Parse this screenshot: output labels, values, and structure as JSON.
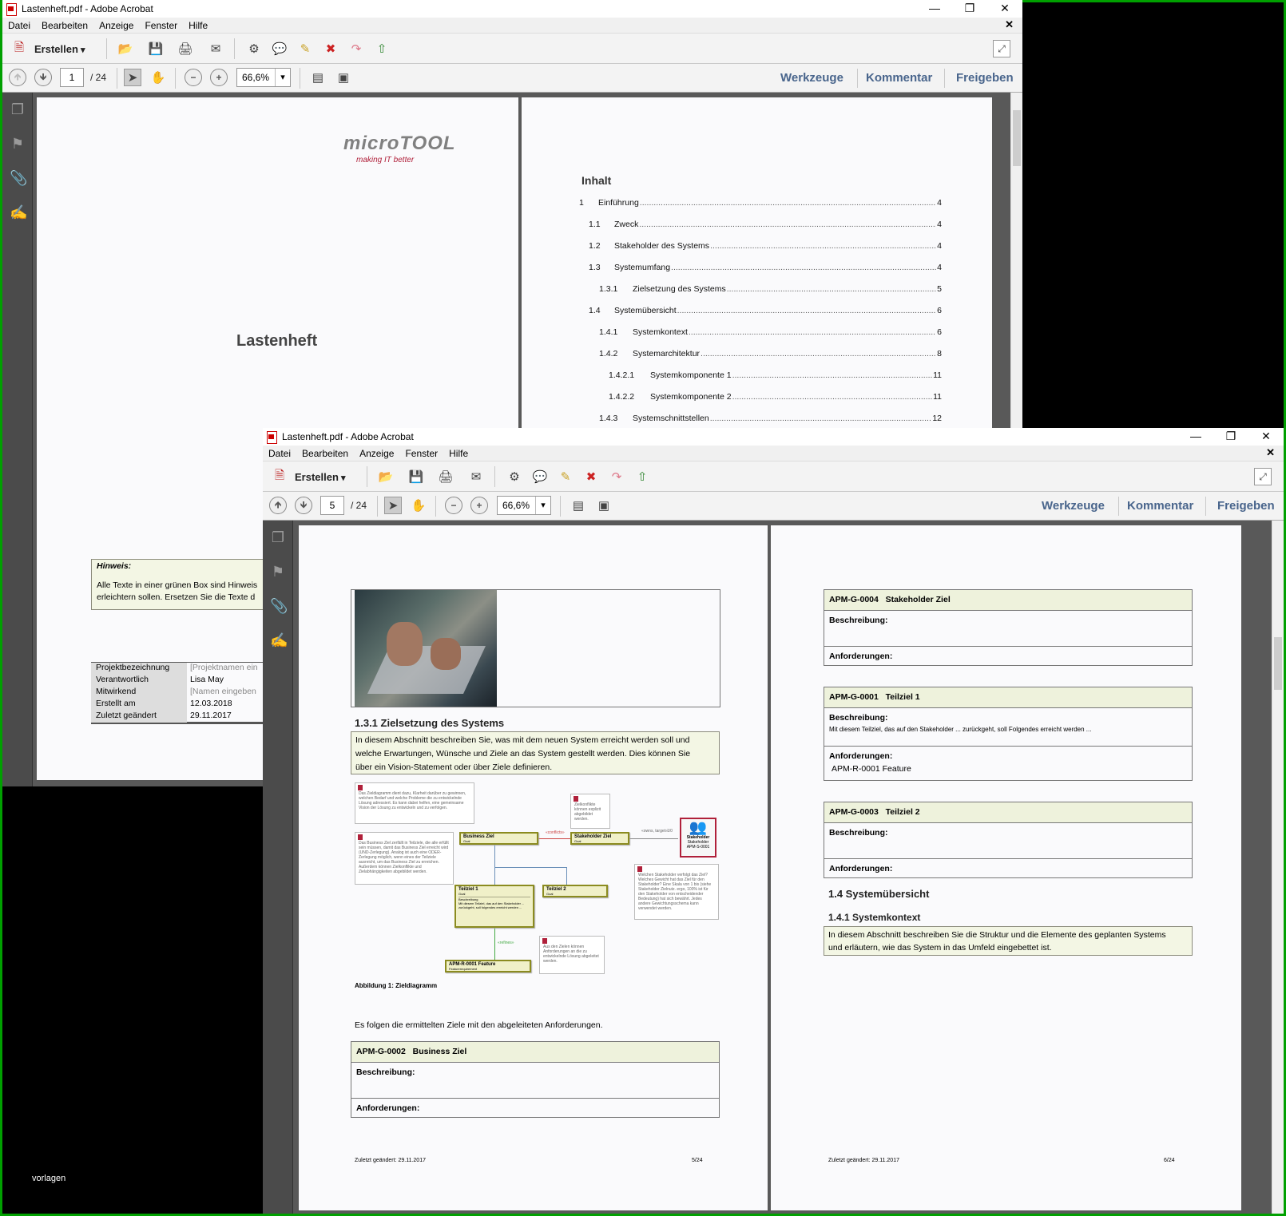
{
  "colors": {
    "frame_border": "#00a000",
    "link_blue": "#49658c",
    "note_green": "#f3f6e4",
    "req_header": "#eef2dc"
  },
  "window1": {
    "title": "Lastenheft.pdf - Adobe Acrobat",
    "menu": [
      "Datei",
      "Bearbeiten",
      "Anzeige",
      "Fenster",
      "Hilfe"
    ],
    "erstellen": "Erstellen",
    "page_current": "1",
    "page_total": "/ 24",
    "zoom": "66,6%",
    "right_links": [
      "Werkzeuge",
      "Kommentar",
      "Freigeben"
    ],
    "cover": {
      "logo": "microTOOL",
      "slogan": "making IT better",
      "title": "Lastenheft",
      "hint_title": "Hinweis:",
      "hint_lines": [
        "Alle Texte in einer grünen Box sind Hinweis",
        "erleichtern sollen. Ersetzen Sie die Texte d"
      ],
      "meta": [
        {
          "k": "Projektbezeichnung",
          "v": "[Projektnamen ein"
        },
        {
          "k": "Verantwortlich",
          "v": "Lisa May"
        },
        {
          "k": "Mitwirkend",
          "v": "[Namen eingeben"
        },
        {
          "k": "Erstellt am",
          "v": "12.03.2018"
        },
        {
          "k": "Zuletzt geändert",
          "v": "29.11.2017"
        }
      ],
      "footer_text": "vorlagen"
    },
    "toc_title": "Inhalt",
    "toc": [
      {
        "num": "1",
        "text": "Einführung",
        "page": "4"
      },
      {
        "num": "1.1",
        "text": "Zweck",
        "page": "4"
      },
      {
        "num": "1.2",
        "text": "Stakeholder des Systems",
        "page": "4"
      },
      {
        "num": "1.3",
        "text": "Systemumfang",
        "page": "4"
      },
      {
        "num": "1.3.1",
        "text": "Zielsetzung des Systems",
        "page": "5"
      },
      {
        "num": "1.4",
        "text": "Systemübersicht",
        "page": "6"
      },
      {
        "num": "1.4.1",
        "text": "Systemkontext",
        "page": "6"
      },
      {
        "num": "1.4.2",
        "text": "Systemarchitektur",
        "page": "8"
      },
      {
        "num": "1.4.2.1",
        "text": "Systemkomponente 1",
        "page": "11"
      },
      {
        "num": "1.4.2.2",
        "text": "Systemkomponente 2",
        "page": "11"
      },
      {
        "num": "1.4.3",
        "text": "Systemschnittstellen",
        "page": "12"
      }
    ]
  },
  "window2": {
    "title": "Lastenheft.pdf - Adobe Acrobat",
    "menu": [
      "Datei",
      "Bearbeiten",
      "Anzeige",
      "Fenster",
      "Hilfe"
    ],
    "erstellen": "Erstellen",
    "page_current": "5",
    "page_total": "/ 24",
    "zoom": "66,6%",
    "right_links": [
      "Werkzeuge",
      "Kommentar",
      "Freigeben"
    ],
    "page5": {
      "section_heading": "1.3.1  Zielsetzung des Systems",
      "intro_lines": [
        "In diesem Abschnitt beschreiben Sie, was mit dem neuen System erreicht werden soll und",
        "welche Erwartungen, Wünsche und Ziele an das System gestellt werden. Dies können Sie",
        "über ein Vision-Statement oder über Ziele definieren."
      ],
      "diagram": {
        "business_goal": "Business Ziel",
        "business_goal_sub": "Goal",
        "stakeholder_goal": "Stakeholder Ziel",
        "stakeholder_goal_sub": "Goal",
        "partial1": "Teilziel 1",
        "partial1_sub": "Goal",
        "partial1_desc": "Beschreibung",
        "partial1_text": "Mit diesem Teilziel, das auf den Stakeholder ... zurückgeht, soll folgendes erreicht werden ...",
        "partial2": "Teilziel 2",
        "partial2_sub": "Goal",
        "feature": "APM-R-0001   Feature",
        "feature_sub": "Featurerequirement",
        "stakeholder": "Stakeholder",
        "stakeholder_sub": "Stakeholder",
        "stakeholder_id": "APM-S-0001",
        "conflicts": "«conflicts»",
        "refines": "«refines»",
        "owns": "«owns, target»",
        "owns_mult": "1/0",
        "note1": "Das Zieldiagramm dient dazu, Klarheit darüber zu gewinnen, welchen Bedarf und welche Probleme die zu entwickelnde Lösung adressiert. Es kann dabei helfen, eine gemeinsame Vision der Lösung zu entwickeln und zu verfolgen.",
        "note2": "Das Business Ziel zerfällt in Teilziele, die alle erfüllt sein müssen, damit das Business Ziel erreicht wird (UND-Zerlegung). Analog ist auch eine ODER-Zerlegung möglich, wenn eines der Teilziele ausreicht, um das Business Ziel zu erreichen. Außerdem können Zielkonflikte und Zielabhängigkeiten abgebildet werden.",
        "note3": "Zielkonflikte können explizit abgebildet werden.",
        "note4": "Welchen Stakeholder verfolgt das Ziel? Welches Gewicht hat das Ziel für den Stakeholder? Eine Skala von 1 bis (siehe Stakeholder Zielnutz. ergo, 100% ist für den Stakeholder von entscheidender Bedeutung) hat sich bewährt. Jedes andere Gewichtungsschema kann verwendet werden.",
        "note5": "Aus den Zielen können Anforderungen an die zu entwickelnde Lösung abgeleitet werden."
      },
      "caption": "Abbildung 1: Zieldiagramm",
      "follow_text": "Es folgen die ermittelten Ziele mit den abgeleiteten Anforderungen.",
      "req": {
        "id": "APM-G-0002",
        "name": "Business Ziel",
        "desc_label": "Beschreibung:",
        "req_label": "Anforderungen:"
      },
      "footer_left": "Zuletzt geändert: 29.11.2017",
      "footer_right": "5/24"
    },
    "page6": {
      "boxes": [
        {
          "id": "APM-G-0004",
          "name": "Stakeholder Ziel",
          "desc_label": "Beschreibung:",
          "desc_text": "",
          "req_label": "Anforderungen:",
          "req_text": ""
        },
        {
          "id": "APM-G-0001",
          "name": "Teilziel 1",
          "desc_label": "Beschreibung:",
          "desc_text": "Mit diesem Teilziel, das auf den Stakeholder ... zurückgeht, soll Folgendes erreicht werden ...",
          "req_label": "Anforderungen:",
          "req_text": "APM-R-0001    Feature"
        },
        {
          "id": "APM-G-0003",
          "name": "Teilziel 2",
          "desc_label": "Beschreibung:",
          "desc_text": "",
          "req_label": "Anforderungen:",
          "req_text": ""
        }
      ],
      "heading1": "1.4  Systemübersicht",
      "heading2": "1.4.1  Systemkontext",
      "context_lines": [
        "In diesem Abschnitt beschreiben Sie die Struktur und die Elemente des geplanten Systems",
        "und erläutern, wie das System in das Umfeld eingebettet ist."
      ],
      "footer_left": "Zuletzt geändert: 29.11.2017",
      "footer_right": "6/24"
    }
  }
}
